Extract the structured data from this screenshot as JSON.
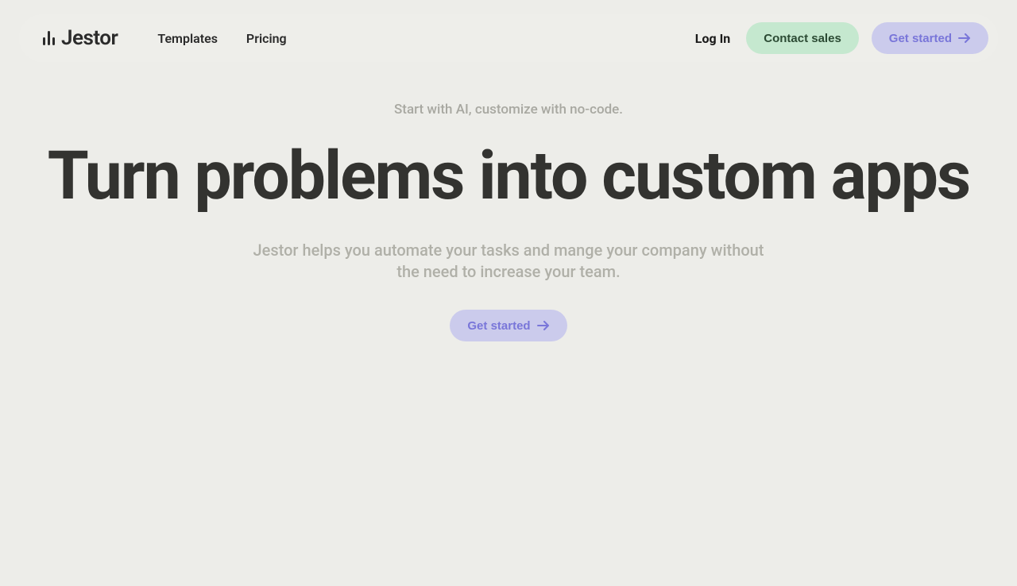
{
  "brand": {
    "name": "Jestor"
  },
  "nav": {
    "items": [
      {
        "label": "Templates"
      },
      {
        "label": "Pricing"
      }
    ]
  },
  "actions": {
    "login": "Log In",
    "contact_sales": "Contact sales",
    "get_started": "Get started"
  },
  "hero": {
    "eyebrow": "Start with AI, customize with no-code.",
    "headline": "Turn problems into custom apps",
    "subhead": "Jestor helps you automate your tasks and mange your company without the need to increase your team.",
    "cta": "Get started"
  },
  "colors": {
    "page_bg": "#edede9",
    "text_dark": "#333330",
    "text_muted": "#a8a8a1",
    "btn_green_bg": "#c5e8cf",
    "btn_green_text": "#2b4a33",
    "btn_purple_bg": "#cbcbec",
    "btn_purple_text": "#7976d9"
  }
}
